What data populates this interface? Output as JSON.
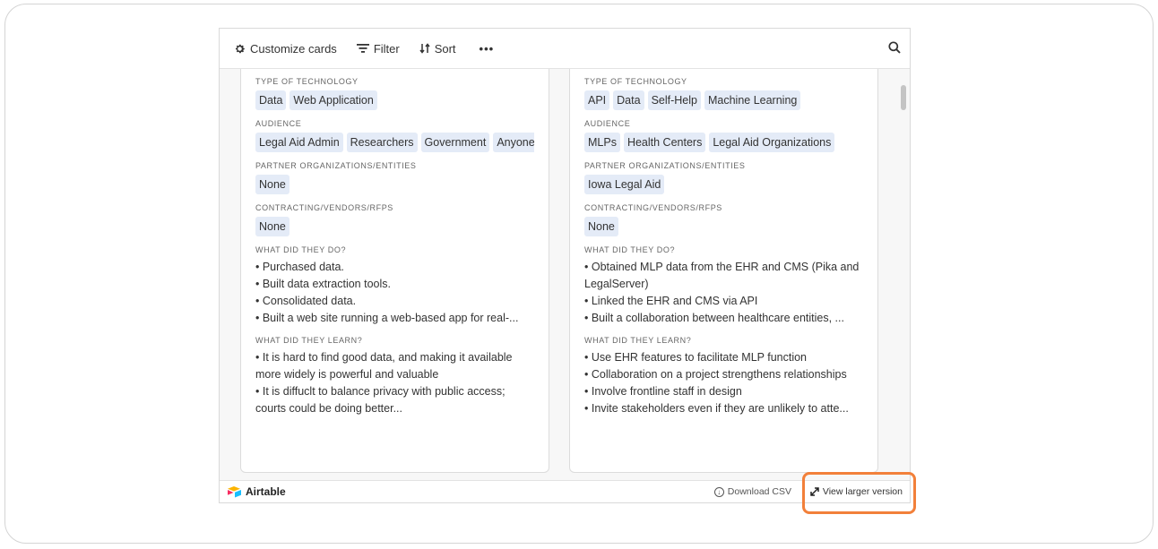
{
  "toolbar": {
    "customize_label": "Customize cards",
    "filter_label": "Filter",
    "sort_label": "Sort",
    "more_label": "•••",
    "icons": [
      "gear-icon",
      "filter-icon",
      "sort-icon",
      "more-icon",
      "search-icon"
    ]
  },
  "cards": [
    {
      "type_label": "TYPE OF TECHNOLOGY",
      "type_tags": [
        "Data",
        "Web Application"
      ],
      "audience_label": "AUDIENCE",
      "audience_tags": [
        "Legal Aid Admin",
        "Researchers",
        "Government",
        "Anyone"
      ],
      "partner_label": "PARTNER ORGANIZATIONS/ENTITIES",
      "partner_tags": [
        "None"
      ],
      "contracting_label": "CONTRACTING/VENDORS/RFPS",
      "contracting_tags": [
        "None"
      ],
      "did_label": "WHAT DID THEY DO?",
      "did_items": [
        "• Purchased data.",
        "• Built data extraction tools.",
        "• Consolidated data.",
        "• Built a web site running a web-based app for real-..."
      ],
      "learn_label": "WHAT DID THEY LEARN?",
      "learn_items": [
        "• It is hard to find good data, and making it available more widely is powerful and valuable",
        "• It is diffuclt to balance privacy with public access; courts could be doing better..."
      ]
    },
    {
      "type_label": "TYPE OF TECHNOLOGY",
      "type_tags": [
        "API",
        "Data",
        "Self-Help",
        "Machine Learning"
      ],
      "audience_label": "AUDIENCE",
      "audience_tags": [
        "MLPs",
        "Health Centers",
        "Legal Aid Organizations"
      ],
      "partner_label": "PARTNER ORGANIZATIONS/ENTITIES",
      "partner_tags": [
        "Iowa Legal Aid"
      ],
      "contracting_label": "CONTRACTING/VENDORS/RFPS",
      "contracting_tags": [
        "None"
      ],
      "did_label": "WHAT DID THEY DO?",
      "did_items": [
        "• Obtained MLP data from the EHR and CMS (Pika and LegalServer)",
        "• Linked the EHR and CMS via API",
        "• Built a collaboration between healthcare entities, ..."
      ],
      "learn_label": "WHAT DID THEY LEARN?",
      "learn_items": [
        "• Use EHR features to facilitate MLP function",
        "• Collaboration on a project strengthens relationships",
        "• Involve frontline staff in design",
        "• Invite stakeholders even if they are unlikely to atte..."
      ]
    }
  ],
  "footer": {
    "brand": "Airtable",
    "download_label": "Download CSV",
    "larger_label": "View larger version"
  },
  "colors": {
    "tag_bg": "#e4ebf7",
    "highlight": "#f2803a"
  }
}
